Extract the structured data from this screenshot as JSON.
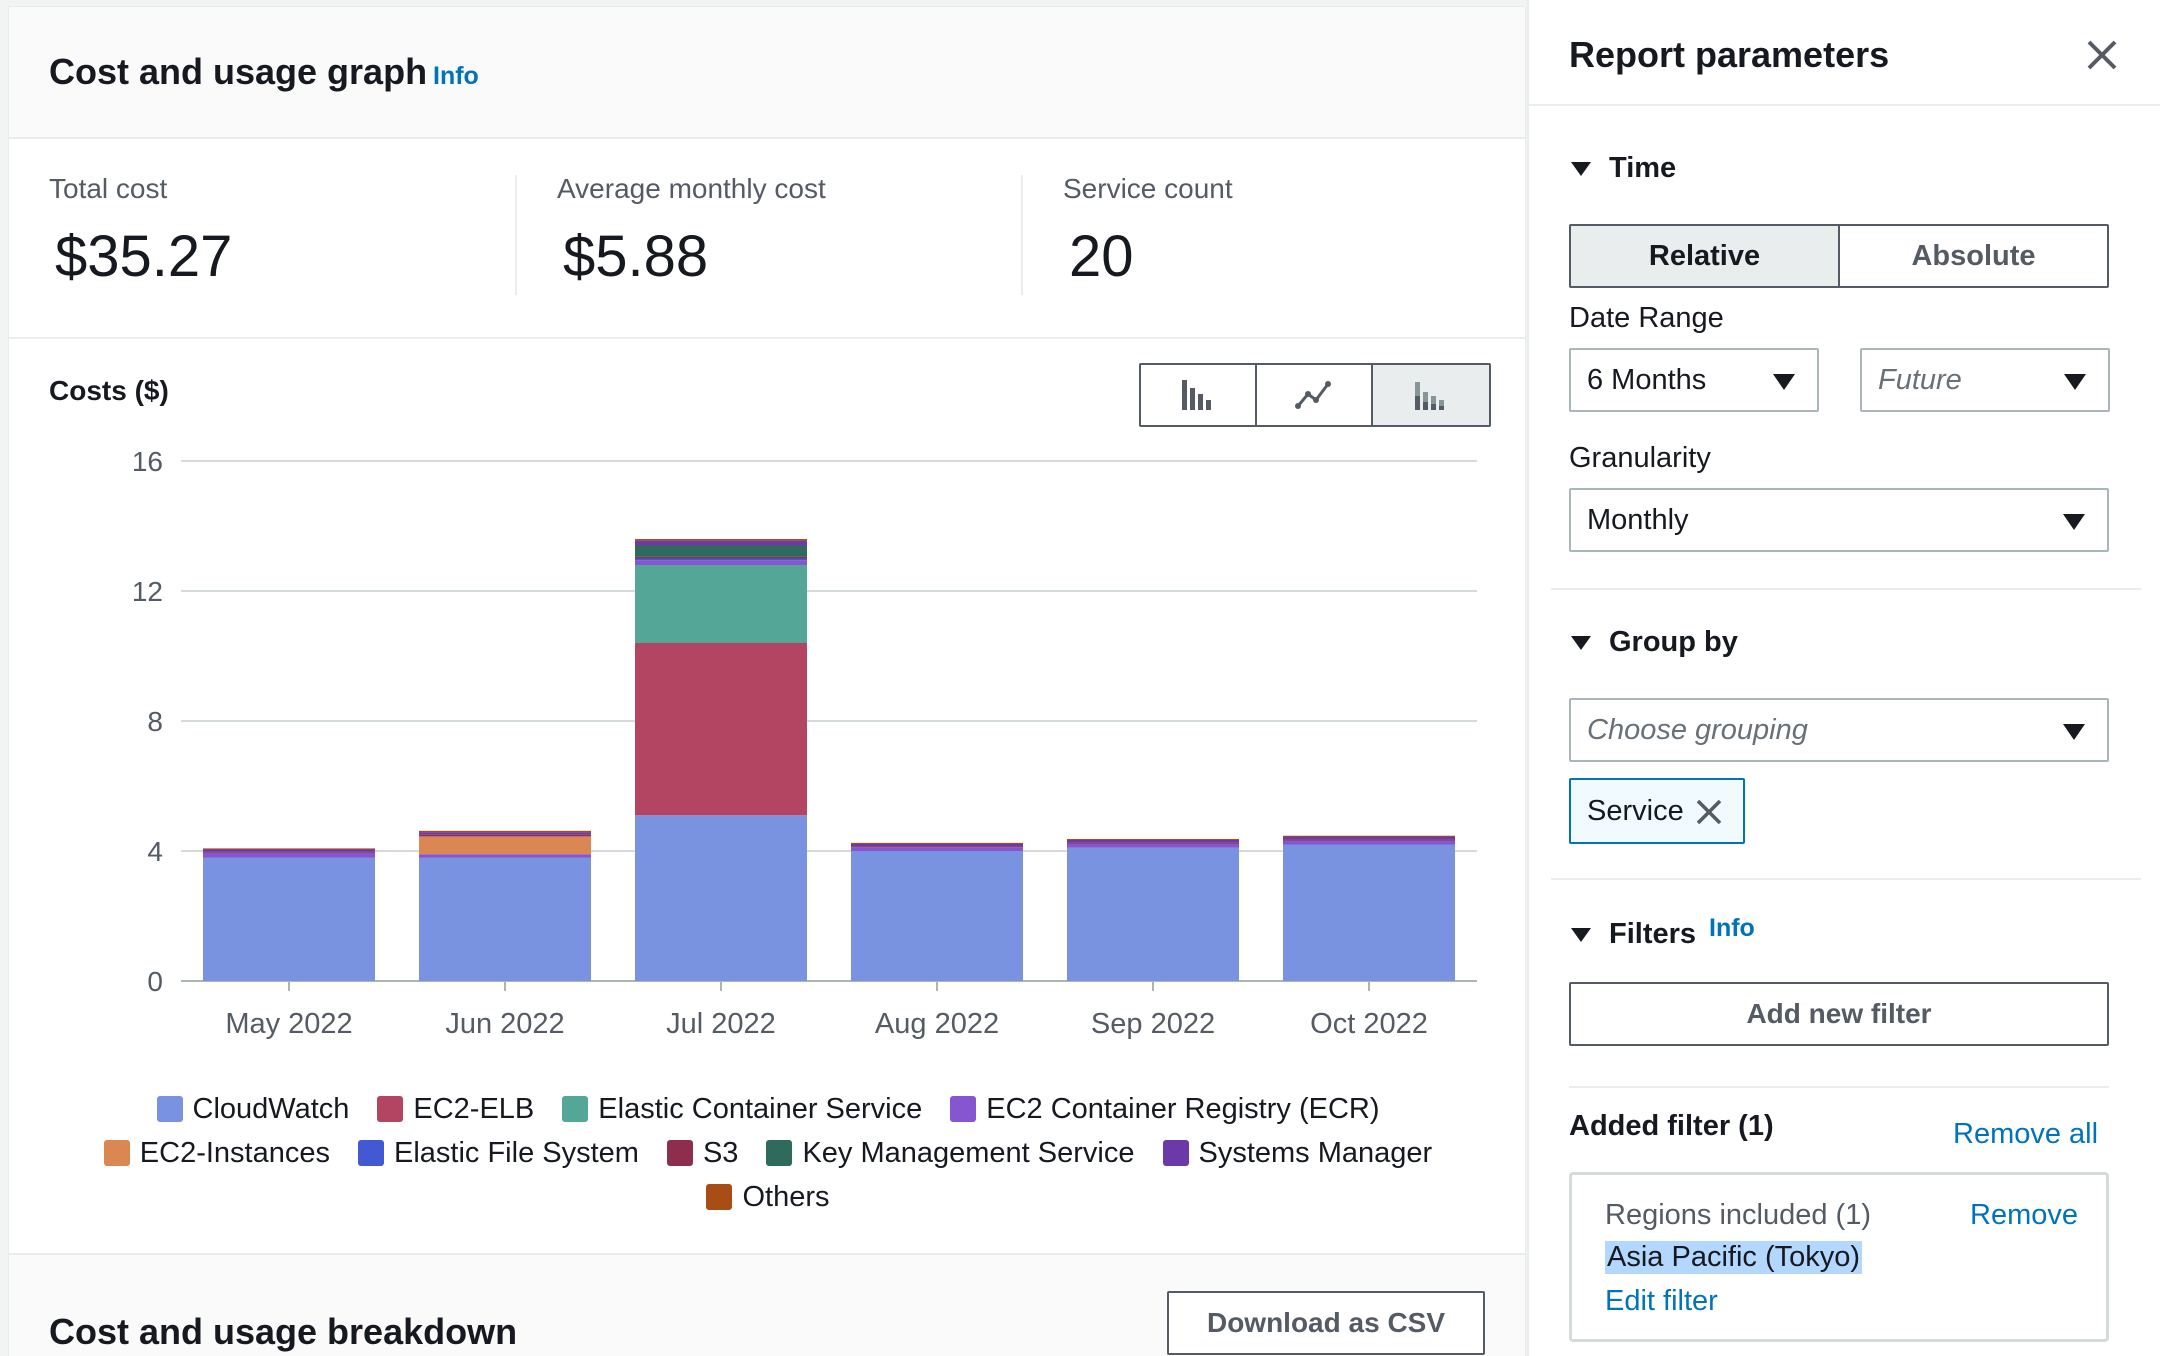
{
  "main": {
    "title": "Cost and usage graph",
    "info_label": "Info",
    "kpis": [
      {
        "label": "Total cost",
        "value": "$35.27"
      },
      {
        "label": "Average monthly cost",
        "value": "$5.88"
      },
      {
        "label": "Service count",
        "value": "20"
      }
    ],
    "chart_title": "Costs ($)",
    "chart_types": [
      "bar-chart-icon",
      "line-chart-icon",
      "stacked-bar-chart-icon"
    ],
    "breakdown_title": "Cost and usage breakdown",
    "download_label": "Download as CSV"
  },
  "chart_data": {
    "type": "bar",
    "stacked": true,
    "title": "",
    "ylabel": "Costs ($)",
    "ylim": [
      0,
      16
    ],
    "yticks": [
      "0",
      "4",
      "8",
      "12",
      "16"
    ],
    "categories": [
      "May 2022",
      "Jun 2022",
      "Jul 2022",
      "Aug 2022",
      "Sep 2022",
      "Oct 2022"
    ],
    "series": [
      {
        "name": "CloudWatch",
        "color": "#7a93e1",
        "values": [
          3.8,
          3.8,
          5.1,
          4.0,
          4.1,
          4.2
        ]
      },
      {
        "name": "EC2-ELB",
        "color": "#b34462",
        "values": [
          0,
          0,
          5.3,
          0,
          0,
          0
        ]
      },
      {
        "name": "Elastic Container Service",
        "color": "#54a697",
        "values": [
          0,
          0,
          2.4,
          0,
          0,
          0
        ]
      },
      {
        "name": "EC2 Container Registry (ECR)",
        "color": "#8656d1",
        "values": [
          0.15,
          0.1,
          0.15,
          0.12,
          0.12,
          0.12
        ]
      },
      {
        "name": "EC2-Instances",
        "color": "#db8754",
        "values": [
          0,
          0.55,
          0,
          0,
          0,
          0
        ]
      },
      {
        "name": "Elastic File System",
        "color": "#4359d4",
        "values": [
          0,
          0,
          0.05,
          0,
          0,
          0
        ]
      },
      {
        "name": "S3",
        "color": "#8d2e4f",
        "values": [
          0.03,
          0.05,
          0.05,
          0.03,
          0.03,
          0.03
        ]
      },
      {
        "name": "Key Management Service",
        "color": "#2e6b5c",
        "values": [
          0,
          0,
          0.35,
          0,
          0,
          0
        ]
      },
      {
        "name": "Systems Manager",
        "color": "#6b3aa8",
        "values": [
          0.08,
          0.08,
          0.15,
          0.08,
          0.1,
          0.1
        ]
      },
      {
        "name": "Others",
        "color": "#a84d16",
        "values": [
          0.02,
          0.04,
          0.05,
          0.02,
          0.02,
          0.02
        ]
      }
    ],
    "legend_position": "bottom",
    "grid": true
  },
  "side": {
    "title": "Report parameters",
    "time_label": "Time",
    "relative_label": "Relative",
    "absolute_label": "Absolute",
    "date_range_label": "Date Range",
    "date_range_value": "6 Months",
    "future_placeholder": "Future",
    "granularity_label": "Granularity",
    "granularity_value": "Monthly",
    "group_by_label": "Group by",
    "grouping_placeholder": "Choose grouping",
    "group_token": "Service",
    "filters_label": "Filters",
    "filters_info": "Info",
    "add_filter_label": "Add new filter",
    "added_filter_label": "Added filter (1)",
    "remove_all_label": "Remove all",
    "filter_card": {
      "title": "Regions included (1)",
      "remove_label": "Remove",
      "value": "Asia Pacific (Tokyo)",
      "edit_label": "Edit filter"
    }
  }
}
